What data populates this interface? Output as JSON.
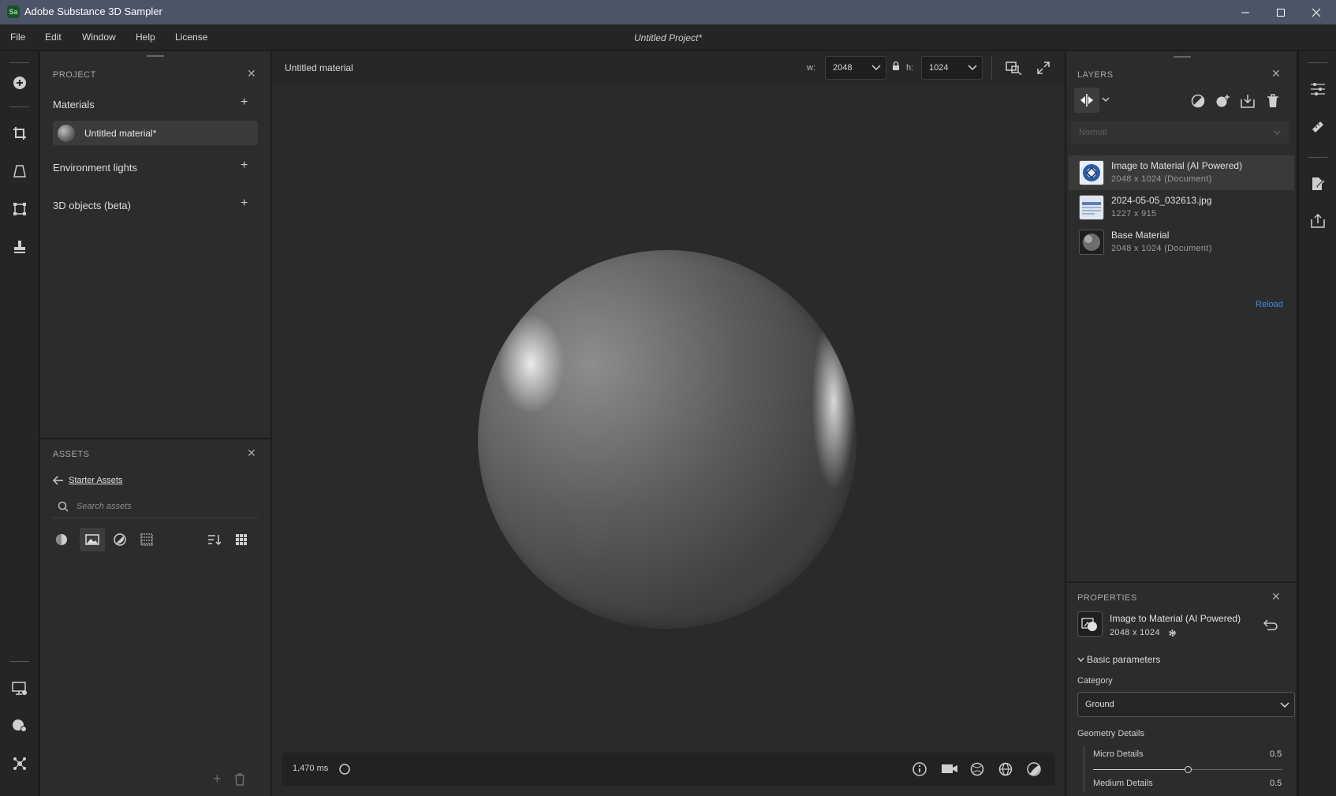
{
  "window": {
    "title": "Adobe Substance 3D Sampler",
    "logo_text": "Sa"
  },
  "menu": {
    "items": [
      "File",
      "Edit",
      "Window",
      "Help",
      "License"
    ],
    "project_name": "Untitled Project*"
  },
  "project_panel": {
    "title": "PROJECT",
    "sections": {
      "materials": "Materials",
      "environment_lights": "Environment lights",
      "objects": "3D objects (beta)"
    },
    "material_item": "Untitled material*"
  },
  "assets_panel": {
    "title": "ASSETS",
    "breadcrumb": "Starter Assets",
    "search_placeholder": "Search assets"
  },
  "viewport": {
    "material_name": "Untitled material",
    "width_label": "w:",
    "width_value": "2048",
    "height_label": "h:",
    "height_value": "1024",
    "render_time": "1,470 ms"
  },
  "layers_panel": {
    "title": "LAYERS",
    "blend_mode": "Normal",
    "layers": [
      {
        "name": "Image to Material (AI Powered)",
        "sub": "2048 x 1024 (Document)"
      },
      {
        "name": "2024-05-05_032613.jpg",
        "sub": "1227 x 915"
      },
      {
        "name": "Base Material",
        "sub": "2048 x 1024 (Document)"
      }
    ],
    "reload_label": "Reload"
  },
  "properties_panel": {
    "title": "PROPERTIES",
    "item_name": "Image to Material (AI Powered)",
    "item_size": "2048 x 1024",
    "basic_params": "Basic parameters",
    "category_label": "Category",
    "category_value": "Ground",
    "geometry_label": "Geometry Details",
    "micro_label": "Micro Details",
    "micro_value": "0.5",
    "medium_label": "Medium Details",
    "medium_value": "0.5",
    "micro_slider_fraction": 0.5
  },
  "colors": {
    "accent": "#3d8be8",
    "titlebar": "#4b5567",
    "panel": "#2c2c2c"
  }
}
